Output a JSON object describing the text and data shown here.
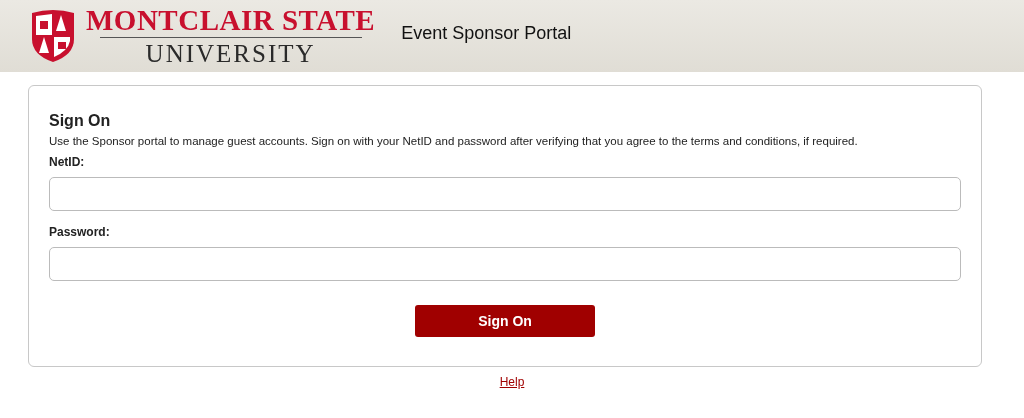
{
  "header": {
    "logo": {
      "line_1": "MONTCLAIR STATE",
      "line_2": "UNIVERSITY"
    },
    "portal_title": "Event Sponsor Portal"
  },
  "sign_on": {
    "title": "Sign On",
    "description": "Use the Sponsor portal to manage guest accounts. Sign on with your NetID and password after verifying that you agree to the terms and conditions, if required.",
    "fields": [
      {
        "label": "NetID:"
      },
      {
        "label": "Password:"
      }
    ],
    "button": "Sign On"
  },
  "footer": {
    "link": "Help"
  }
}
